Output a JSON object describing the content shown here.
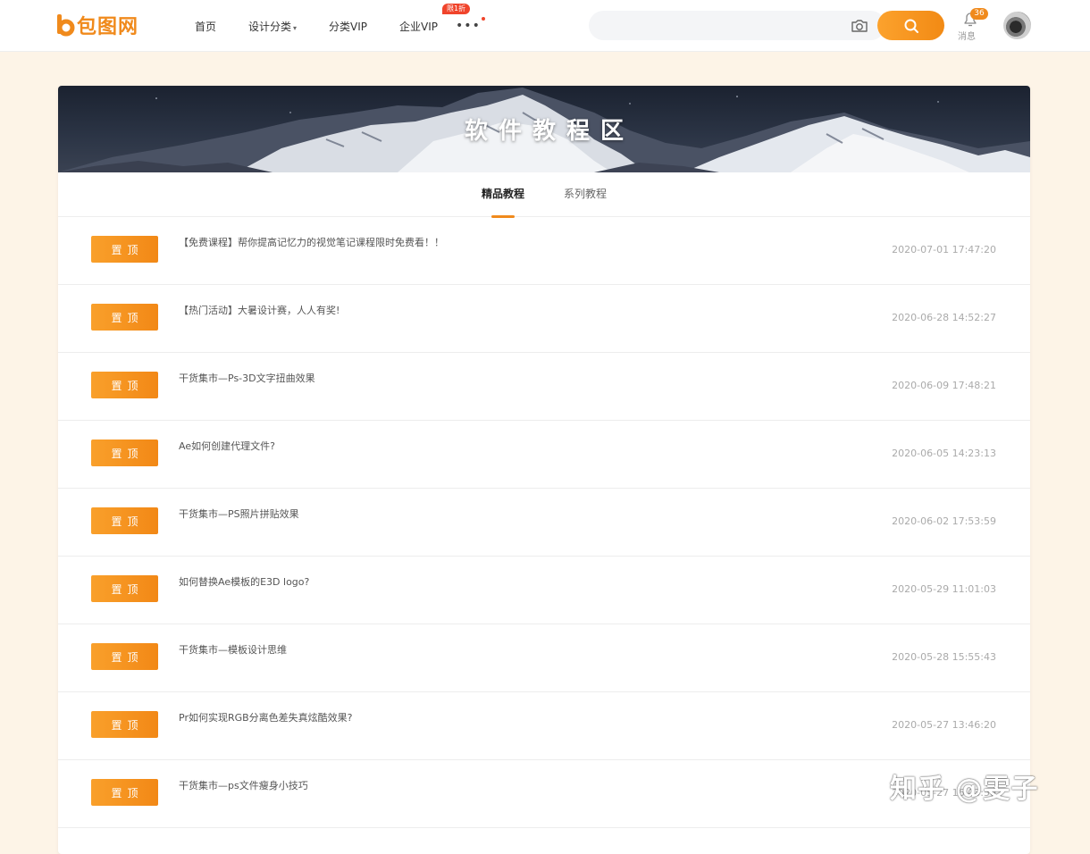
{
  "brand": {
    "name": "包图网",
    "accent": "#f08a1c"
  },
  "nav": {
    "items": [
      {
        "label": "首页"
      },
      {
        "label": "设计分类"
      },
      {
        "label": "分类VIP"
      },
      {
        "label": "企业VIP"
      }
    ],
    "badge": "限1折",
    "more": "•••"
  },
  "search": {
    "placeholder": ""
  },
  "messages": {
    "label": "消息",
    "count": "36"
  },
  "banner": {
    "title": "软件教程区"
  },
  "tabs": [
    {
      "label": "精品教程",
      "active": true
    },
    {
      "label": "系列教程",
      "active": false
    }
  ],
  "posts": [
    {
      "tag": "置顶",
      "title": "【免费课程】帮你提高记忆力的视觉笔记课程限时免费看！！",
      "date": "2020-07-01 17:47:20"
    },
    {
      "tag": "置顶",
      "title": "【热门活动】大暑设计赛，人人有奖!",
      "date": "2020-06-28 14:52:27"
    },
    {
      "tag": "置顶",
      "title": "干货集市—Ps-3D文字扭曲效果",
      "date": "2020-06-09 17:48:21"
    },
    {
      "tag": "置顶",
      "title": "Ae如何创建代理文件?",
      "date": "2020-06-05 14:23:13"
    },
    {
      "tag": "置顶",
      "title": "干货集市—PS照片拼贴效果",
      "date": "2020-06-02 17:53:59"
    },
    {
      "tag": "置顶",
      "title": "如何替换Ae模板的E3D logo?",
      "date": "2020-05-29 11:01:03"
    },
    {
      "tag": "置顶",
      "title": "干货集市—模板设计思维",
      "date": "2020-05-28 15:55:43"
    },
    {
      "tag": "置顶",
      "title": "Pr如何实现RGB分离色差失真炫酷效果?",
      "date": "2020-05-27 13:46:20"
    },
    {
      "tag": "置顶",
      "title": "干货集市—ps文件瘦身小技巧",
      "date": "2020-05-27 16:03:50"
    }
  ],
  "watermark": "知乎 @雯子"
}
